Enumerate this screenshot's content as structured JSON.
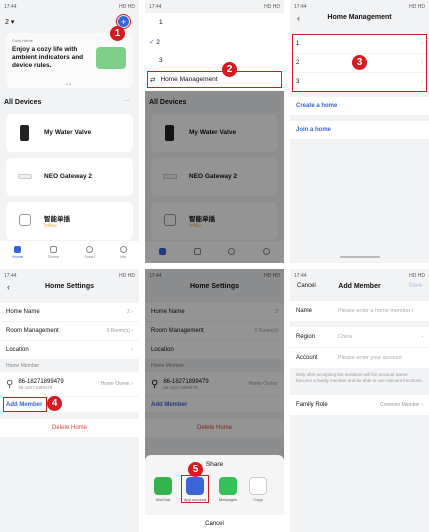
{
  "status": {
    "time": "17:44",
    "right": "HD HD"
  },
  "s1": {
    "home_label": "2",
    "card_title": "Enjoy a cozy life with ambient indicators and device rules.",
    "card_small": "Cozy Home",
    "section": "All Devices",
    "more": "···",
    "devices": [
      "My Water Valve",
      "NEO Gateway 2",
      "智能单插"
    ],
    "offline": "Offline",
    "tabs": [
      "Home",
      "Scene",
      "Smart",
      "Me"
    ],
    "badge": "1"
  },
  "s2": {
    "items": [
      "1",
      "2",
      "3"
    ],
    "check": "✓",
    "manage": "Home Management",
    "section": "All Devices",
    "devices": [
      "My Water Valve",
      "NEO Gateway 2",
      "智能单插"
    ],
    "offline": "Offline",
    "badge": "2"
  },
  "s3": {
    "title": "Home Management",
    "items": [
      "1",
      "2",
      "3"
    ],
    "create": "Create a home",
    "join": "Join a home",
    "badge": "3"
  },
  "s4": {
    "title": "Home Settings",
    "rows": [
      {
        "label": "Home Name",
        "value": "2"
      },
      {
        "label": "Room Management",
        "value": "0 Room(s)"
      },
      {
        "label": "Location",
        "value": ""
      }
    ],
    "member_header": "Home Member",
    "member_name": "86-18271899479",
    "member_sub": "86-18271899479",
    "member_role": "Home Owner",
    "add_member": "Add Member",
    "delete": "Delete Home",
    "badge": "4"
  },
  "s5": {
    "title": "Home Settings",
    "share_title": "Share",
    "apps": [
      "WeChat",
      "App account",
      "Messages",
      "Copy"
    ],
    "cancel": "Cancel",
    "badge": "5"
  },
  "s6": {
    "cancel": "Cancel",
    "title": "Add Member",
    "save": "Save",
    "name_label": "Name",
    "name_ph": "Please enter a home member r",
    "region_label": "Region",
    "region_val": "China",
    "account_label": "Account",
    "account_ph": "Please enter your account",
    "note": "Only after accepting the invitation will the account owner become a family member and be able to use relevant functions.",
    "role_label": "Family Role",
    "role_val": "Common Member"
  }
}
